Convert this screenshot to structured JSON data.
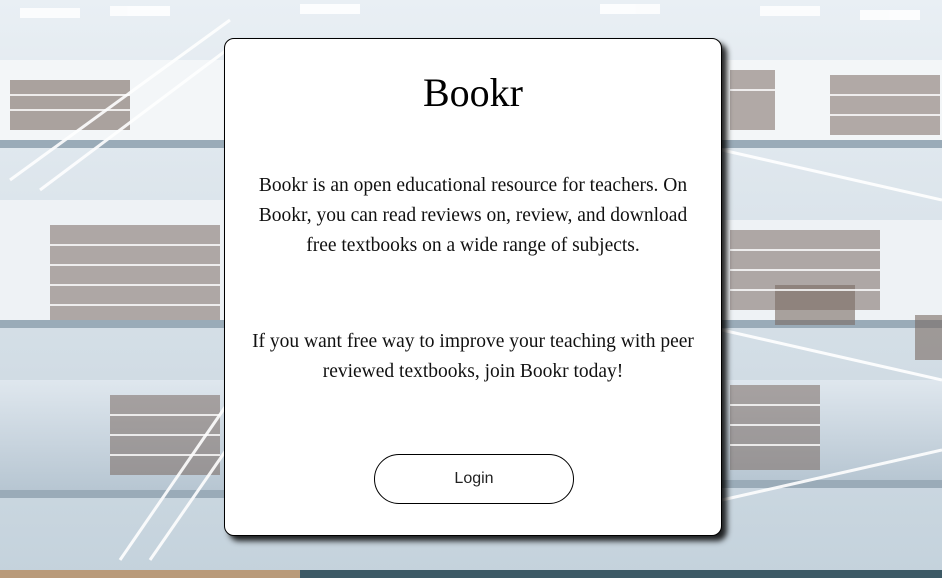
{
  "app": {
    "title": "Bookr"
  },
  "intro": {
    "description": "Bookr is an open educational resource for teachers. On Bookr, you can read reviews on, review, and download free textbooks on a wide range of subjects.",
    "call_to_action": "If you want free way to improve your teaching with peer reviewed textbooks, join Bookr today!"
  },
  "actions": {
    "login_label": "Login"
  }
}
